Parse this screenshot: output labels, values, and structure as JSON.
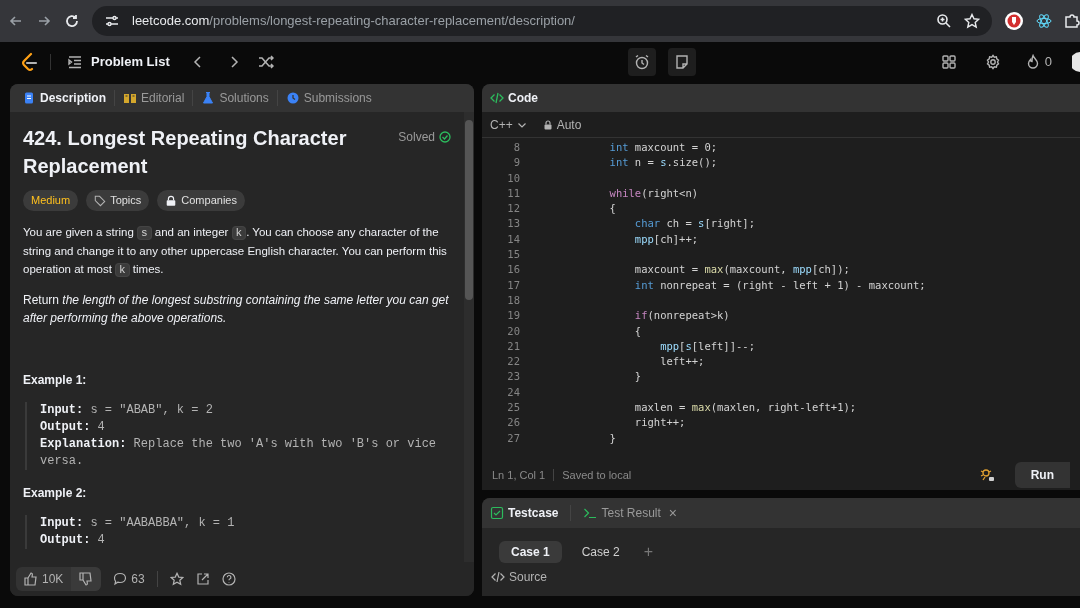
{
  "browser": {
    "url_host": "leetcode.com",
    "url_path": "/problems/longest-repeating-character-replacement/description/"
  },
  "toolbar": {
    "problem_list": "Problem List",
    "streak": "0"
  },
  "left_tabs": [
    {
      "label": "Description",
      "selected": true,
      "color": "#3b82f6"
    },
    {
      "label": "Editorial",
      "selected": false,
      "color": "#d4a72c"
    },
    {
      "label": "Solutions",
      "selected": false,
      "color": "#3b82f6"
    },
    {
      "label": "Submissions",
      "selected": false,
      "color": "#3b82f6"
    }
  ],
  "problem": {
    "title": "424. Longest Repeating Character Replacement",
    "status": "Solved",
    "difficulty": "Medium",
    "tags": [
      "Topics",
      "Companies"
    ],
    "statement": [
      {
        "kind": "text",
        "text": "You are given a string "
      },
      {
        "kind": "code",
        "text": "s"
      },
      {
        "kind": "text",
        "text": " and an integer "
      },
      {
        "kind": "code",
        "text": "k"
      },
      {
        "kind": "text",
        "text": ". You can choose any character of the string and change it to any other uppercase English character. You can perform this operation at most "
      },
      {
        "kind": "code",
        "text": "k"
      },
      {
        "kind": "text",
        "text": " times."
      }
    ],
    "task": "Return *the length of the longest substring containing the same letter you can get after performing the above operations.*",
    "examples": [
      {
        "heading": "Example 1:",
        "lines": [
          {
            "label": "Input:",
            "value": "s = \"ABAB\", k = 2"
          },
          {
            "label": "Output:",
            "value": "4"
          },
          {
            "label": "Explanation:",
            "value": "Replace the two 'A's with two 'B's or vice versa."
          }
        ]
      },
      {
        "heading": "Example 2:",
        "lines": [
          {
            "label": "Input:",
            "value": "s = \"AABABBA\", k = 1"
          },
          {
            "label": "Output:",
            "value": "4"
          }
        ]
      }
    ]
  },
  "footer": {
    "likes": "10K",
    "comments": "63"
  },
  "editor": {
    "title": "Code",
    "language": "C++",
    "mode": "Auto",
    "lines": [
      {
        "number": "8",
        "tokens": [
          {
            "kind": "type",
            "text": "        int"
          },
          {
            "kind": "plain",
            "text": " maxcount = 0;"
          }
        ]
      },
      {
        "number": "9",
        "tokens": [
          {
            "kind": "type",
            "text": "        int"
          },
          {
            "kind": "plain",
            "text": " n = "
          },
          {
            "kind": "var",
            "text": "s"
          },
          {
            "kind": "plain",
            "text": ".size();"
          }
        ]
      },
      {
        "number": "10"
      },
      {
        "number": "11",
        "tokens": [
          {
            "kind": "ctrl",
            "text": "        while"
          },
          {
            "kind": "plain",
            "text": "(right<n)"
          }
        ]
      },
      {
        "number": "12",
        "tokens": [
          {
            "kind": "plain",
            "text": "        {"
          }
        ]
      },
      {
        "number": "13",
        "tokens": [
          {
            "kind": "type",
            "text": "            char"
          },
          {
            "kind": "plain",
            "text": " ch = "
          },
          {
            "kind": "var",
            "text": "s"
          },
          {
            "kind": "plain",
            "text": "[right];"
          }
        ]
      },
      {
        "number": "14",
        "tokens": [
          {
            "kind": "var",
            "text": "            mpp"
          },
          {
            "kind": "plain",
            "text": "[ch]++;"
          }
        ]
      },
      {
        "number": "15"
      },
      {
        "number": "16",
        "tokens": [
          {
            "kind": "plain",
            "text": "            maxcount = "
          },
          {
            "kind": "fn",
            "text": "max"
          },
          {
            "kind": "plain",
            "text": "(maxcount, "
          },
          {
            "kind": "var",
            "text": "mpp"
          },
          {
            "kind": "plain",
            "text": "[ch]);"
          }
        ]
      },
      {
        "number": "17",
        "tokens": [
          {
            "kind": "type",
            "text": "            int"
          },
          {
            "kind": "plain",
            "text": " nonrepeat = (right - left + 1) - maxcount;"
          }
        ]
      },
      {
        "number": "18"
      },
      {
        "number": "19",
        "tokens": [
          {
            "kind": "ctrl",
            "text": "            if"
          },
          {
            "kind": "plain",
            "text": "(nonrepeat>k)"
          }
        ]
      },
      {
        "number": "20",
        "tokens": [
          {
            "kind": "plain",
            "text": "            {"
          }
        ]
      },
      {
        "number": "21",
        "tokens": [
          {
            "kind": "var",
            "text": "                mpp"
          },
          {
            "kind": "plain",
            "text": "["
          },
          {
            "kind": "var",
            "text": "s"
          },
          {
            "kind": "plain",
            "text": "[left]]--;"
          }
        ]
      },
      {
        "number": "22",
        "tokens": [
          {
            "kind": "plain",
            "text": "                left++;"
          }
        ]
      },
      {
        "number": "23",
        "tokens": [
          {
            "kind": "plain",
            "text": "            }"
          }
        ]
      },
      {
        "number": "24"
      },
      {
        "number": "25",
        "tokens": [
          {
            "kind": "plain",
            "text": "            maxlen = "
          },
          {
            "kind": "fn",
            "text": "max"
          },
          {
            "kind": "plain",
            "text": "(maxlen, right-left+1);"
          }
        ]
      },
      {
        "number": "26",
        "tokens": [
          {
            "kind": "plain",
            "text": "            right++;"
          }
        ]
      },
      {
        "number": "27",
        "tokens": [
          {
            "kind": "plain",
            "text": "        }"
          }
        ]
      }
    ],
    "position": "Ln 1, Col 1",
    "saved": "Saved to local",
    "run": "Run"
  },
  "console": {
    "tabs": [
      {
        "label": "Testcase",
        "selected": true
      },
      {
        "label": "Test Result",
        "selected": false
      }
    ],
    "close": "×",
    "cases": [
      {
        "label": "Case 1",
        "selected": true
      },
      {
        "label": "Case 2",
        "selected": false
      }
    ],
    "add": "+",
    "source": "Source"
  }
}
